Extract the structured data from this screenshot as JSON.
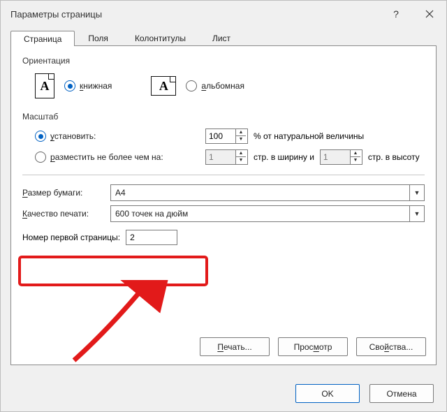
{
  "title": "Параметры страницы",
  "tabs": [
    "Страница",
    "Поля",
    "Колонтитулы",
    "Лист"
  ],
  "active_tab": 0,
  "orientation": {
    "title": "Ориентация",
    "portrait": "книжная",
    "landscape": "альбомная",
    "selected": "portrait"
  },
  "scale": {
    "title": "Масштаб",
    "fixed_label": "установить:",
    "fixed_value": "100",
    "fixed_suffix": "% от натуральной величины",
    "fit_label": "разместить не более чем на:",
    "fit_wide_value": "1",
    "fit_wide_suffix": "стр. в ширину и",
    "fit_tall_value": "1",
    "fit_tall_suffix": "стр. в высоту",
    "selected": "fixed"
  },
  "paper_size": {
    "label": "Размер бумаги:",
    "value": "A4"
  },
  "print_quality": {
    "label": "Качество печати:",
    "value": "600 точек на дюйм"
  },
  "first_page": {
    "label": "Номер первой страницы:",
    "value": "2"
  },
  "inpage_buttons": {
    "print": "Печать...",
    "preview": "Просмотр",
    "properties": "Свойства..."
  },
  "footer_buttons": {
    "ok": "OK",
    "cancel": "Отмена"
  }
}
